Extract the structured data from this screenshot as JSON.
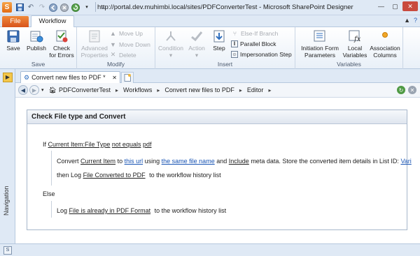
{
  "title_bar": {
    "app_logo": "S",
    "window_title": "http://portal.dev.muhimbi.local/sites/PDFConverterTest - Microsoft SharePoint Designer",
    "quick_access_icons": [
      "save-icon",
      "undo-icon",
      "redo-icon",
      "back-icon",
      "stop-icon",
      "refresh-icon",
      "dropdown-icon"
    ]
  },
  "tabs": {
    "file": "File",
    "workflow": "Workflow"
  },
  "ribbon": {
    "groups": {
      "save": "Save",
      "modify": "Modify",
      "insert": "Insert",
      "variables": "Variables"
    },
    "save_btn": "Save",
    "publish_btn": "Publish",
    "check_errors_line1": "Check",
    "check_errors_line2": "for Errors",
    "advanced_line1": "Advanced",
    "advanced_line2": "Properties",
    "move_up": "Move Up",
    "move_down": "Move Down",
    "delete": "Delete",
    "condition": "Condition",
    "action": "Action",
    "step": "Step",
    "else_if": "Else-If Branch",
    "parallel": "Parallel Block",
    "impersonation": "Impersonation Step",
    "init_line1": "Initiation Form",
    "init_line2": "Parameters",
    "local_line1": "Local",
    "local_line2": "Variables",
    "assoc_line1": "Association",
    "assoc_line2": "Columns"
  },
  "navigation": {
    "label": "Navigation"
  },
  "doc_tab": {
    "label": "Convert new files to PDF *"
  },
  "breadcrumb": {
    "items": [
      "PDFConverterTest",
      "Workflows",
      "Convert new files to PDF",
      "Editor"
    ]
  },
  "workflow": {
    "step_title": "Check File type and Convert",
    "if_kw": "If",
    "if_field": "Current Item:File Type",
    "if_op": "not equals",
    "if_val": "pdf",
    "convert_kw": "Convert",
    "current_item": "Current Item",
    "to_kw": "to",
    "this_url": "this url",
    "using_kw": "using",
    "same_file_name": "the same file name",
    "and_kw": "and",
    "include": "Include",
    "meta_text": "meta data. Store the converted item details in List ID:",
    "list_var": "Vari",
    "then_log_kw": "then Log",
    "log_msg1": "File Converted to PDF",
    "history_text1": "to the workflow history list",
    "else_kw": "Else",
    "log_kw": "Log",
    "log_msg2": "File is already in PDF Format",
    "history_text2": "to the workflow history list"
  },
  "status_bar": {
    "icon": "S"
  }
}
